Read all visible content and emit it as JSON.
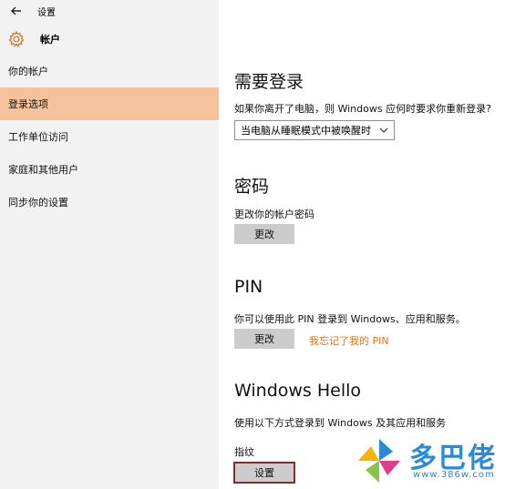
{
  "window": {
    "back_icon": "back-arrow-icon",
    "title": "设置"
  },
  "header": {
    "icon": "gear-icon",
    "title": "帐户"
  },
  "sidebar": {
    "items": [
      {
        "label": "你的帐户",
        "active": false
      },
      {
        "label": "登录选项",
        "active": true
      },
      {
        "label": "工作单位访问",
        "active": false
      },
      {
        "label": "家庭和其他用户",
        "active": false
      },
      {
        "label": "同步你的设置",
        "active": false
      }
    ]
  },
  "main": {
    "require_signin": {
      "title": "需要登录",
      "description": "如果你离开了电脑，则 Windows 应何时要求你重新登录?",
      "select_value": "当电脑从睡眠模式中被唤醒时"
    },
    "password": {
      "title": "密码",
      "description": "更改你的帐户密码",
      "button": "更改"
    },
    "pin": {
      "title": "PIN",
      "description": "你可以使用此 PIN 登录到 Windows、应用和服务。",
      "button": "更改",
      "link": "我忘记了我的 PIN"
    },
    "hello": {
      "title": "Windows Hello",
      "description": "使用以下方式登录到 Windows 及其应用和服务",
      "fingerprint_label": "指纹",
      "setup_button": "设置"
    }
  },
  "watermark": {
    "text": "多巴佬",
    "url": "www.386w.com"
  },
  "colors": {
    "accent": "#f6c29c",
    "link": "#d9731f",
    "button": "#cccccc",
    "sidebar_bg": "#f2f2f2",
    "highlight_border": "#8a2a2a"
  }
}
